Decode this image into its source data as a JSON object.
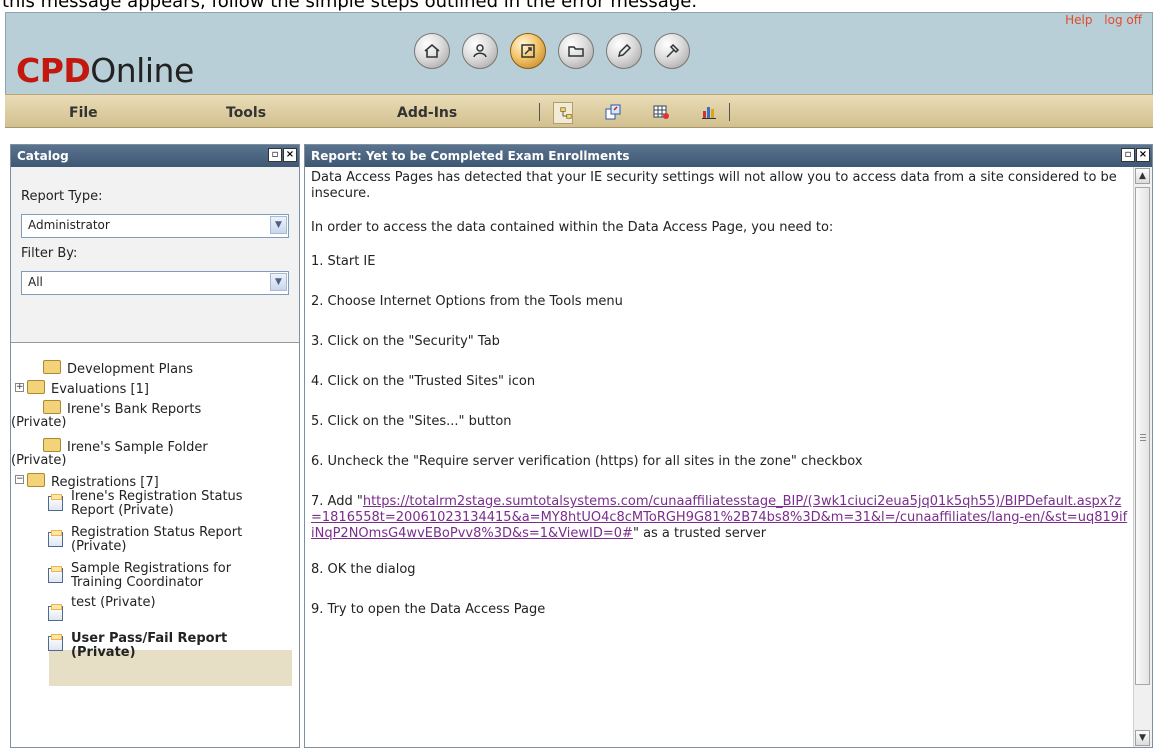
{
  "top_text": "this message appears, follow the simple steps outlined in the error message.",
  "header": {
    "logo_bold": "CPD",
    "logo_light": "Online",
    "links": [
      "Help",
      "log off"
    ],
    "nav_icons": [
      "home-icon",
      "profile-icon",
      "reports-icon",
      "folder-icon",
      "edit-icon",
      "tools-icon"
    ]
  },
  "menu": {
    "items": [
      "File",
      "Tools",
      "Add-Ins"
    ],
    "tool_icons": [
      "hierarchy-icon",
      "copy-icon",
      "grid-icon",
      "chart-icon"
    ]
  },
  "catalog": {
    "title": "Catalog",
    "report_type_label": "Report Type:",
    "report_type_value": "Administrator",
    "filter_label": "Filter By:",
    "filter_value": "All",
    "tree": {
      "development_plans": "Development Plans",
      "evaluations": "Evaluations [1]",
      "irene_bank_1": "Irene's Bank Reports",
      "irene_bank_2": "(Private)",
      "irene_sample_1": "Irene's Sample Folder",
      "irene_sample_2": "(Private)",
      "registrations": "Registrations [7]",
      "r1_a": "Irene's Registration Status",
      "r1_b": "Report (Private)",
      "r2_a": "Registration Status Report",
      "r2_b": "(Private)",
      "r3_a": "Sample Registrations for",
      "r3_b": "Training Coordinator",
      "r4": "test (Private)",
      "r5_a": "User Pass/Fail Report",
      "r5_b": "(Private)"
    }
  },
  "report": {
    "title": "Report: Yet to be Completed Exam Enrollments",
    "intro": "Data Access Pages has detected that your IE security settings will not allow you to access data from a site considered to be insecure.",
    "instruction": "In order to access the data contained within the Data Access Page, you need to:",
    "steps": [
      "1. Start IE",
      "2. Choose Internet Options from the Tools menu",
      "3. Click on the \"Security\" Tab",
      "4. Click on the \"Trusted Sites\" icon",
      "5. Click on the \"Sites...\" button",
      "6. Uncheck the \"Require server verification (https) for all sites in the zone\" checkbox"
    ],
    "step7_prefix": "7. Add \"",
    "step7_link": "https://totalrm2stage.sumtotalsystems.com/cunaaffiliatesstage_BIP/(3wk1ciuci2eua5jq01k5qh55)/BIPDefault.aspx?z=1816558t=20061023134415&a=MY8htUO4c8cMToRGH9G81%2B74bs8%3D&m=31&l=/cunaaffiliates/lang-en/&st=uq819ifiNqP2NOmsG4wvEBoPvv8%3D&s=1&ViewID=0#",
    "step7_suffix": "\" as a trusted server",
    "step8": "8. OK the dialog",
    "step9": "9. Try to open the Data Access Page"
  }
}
